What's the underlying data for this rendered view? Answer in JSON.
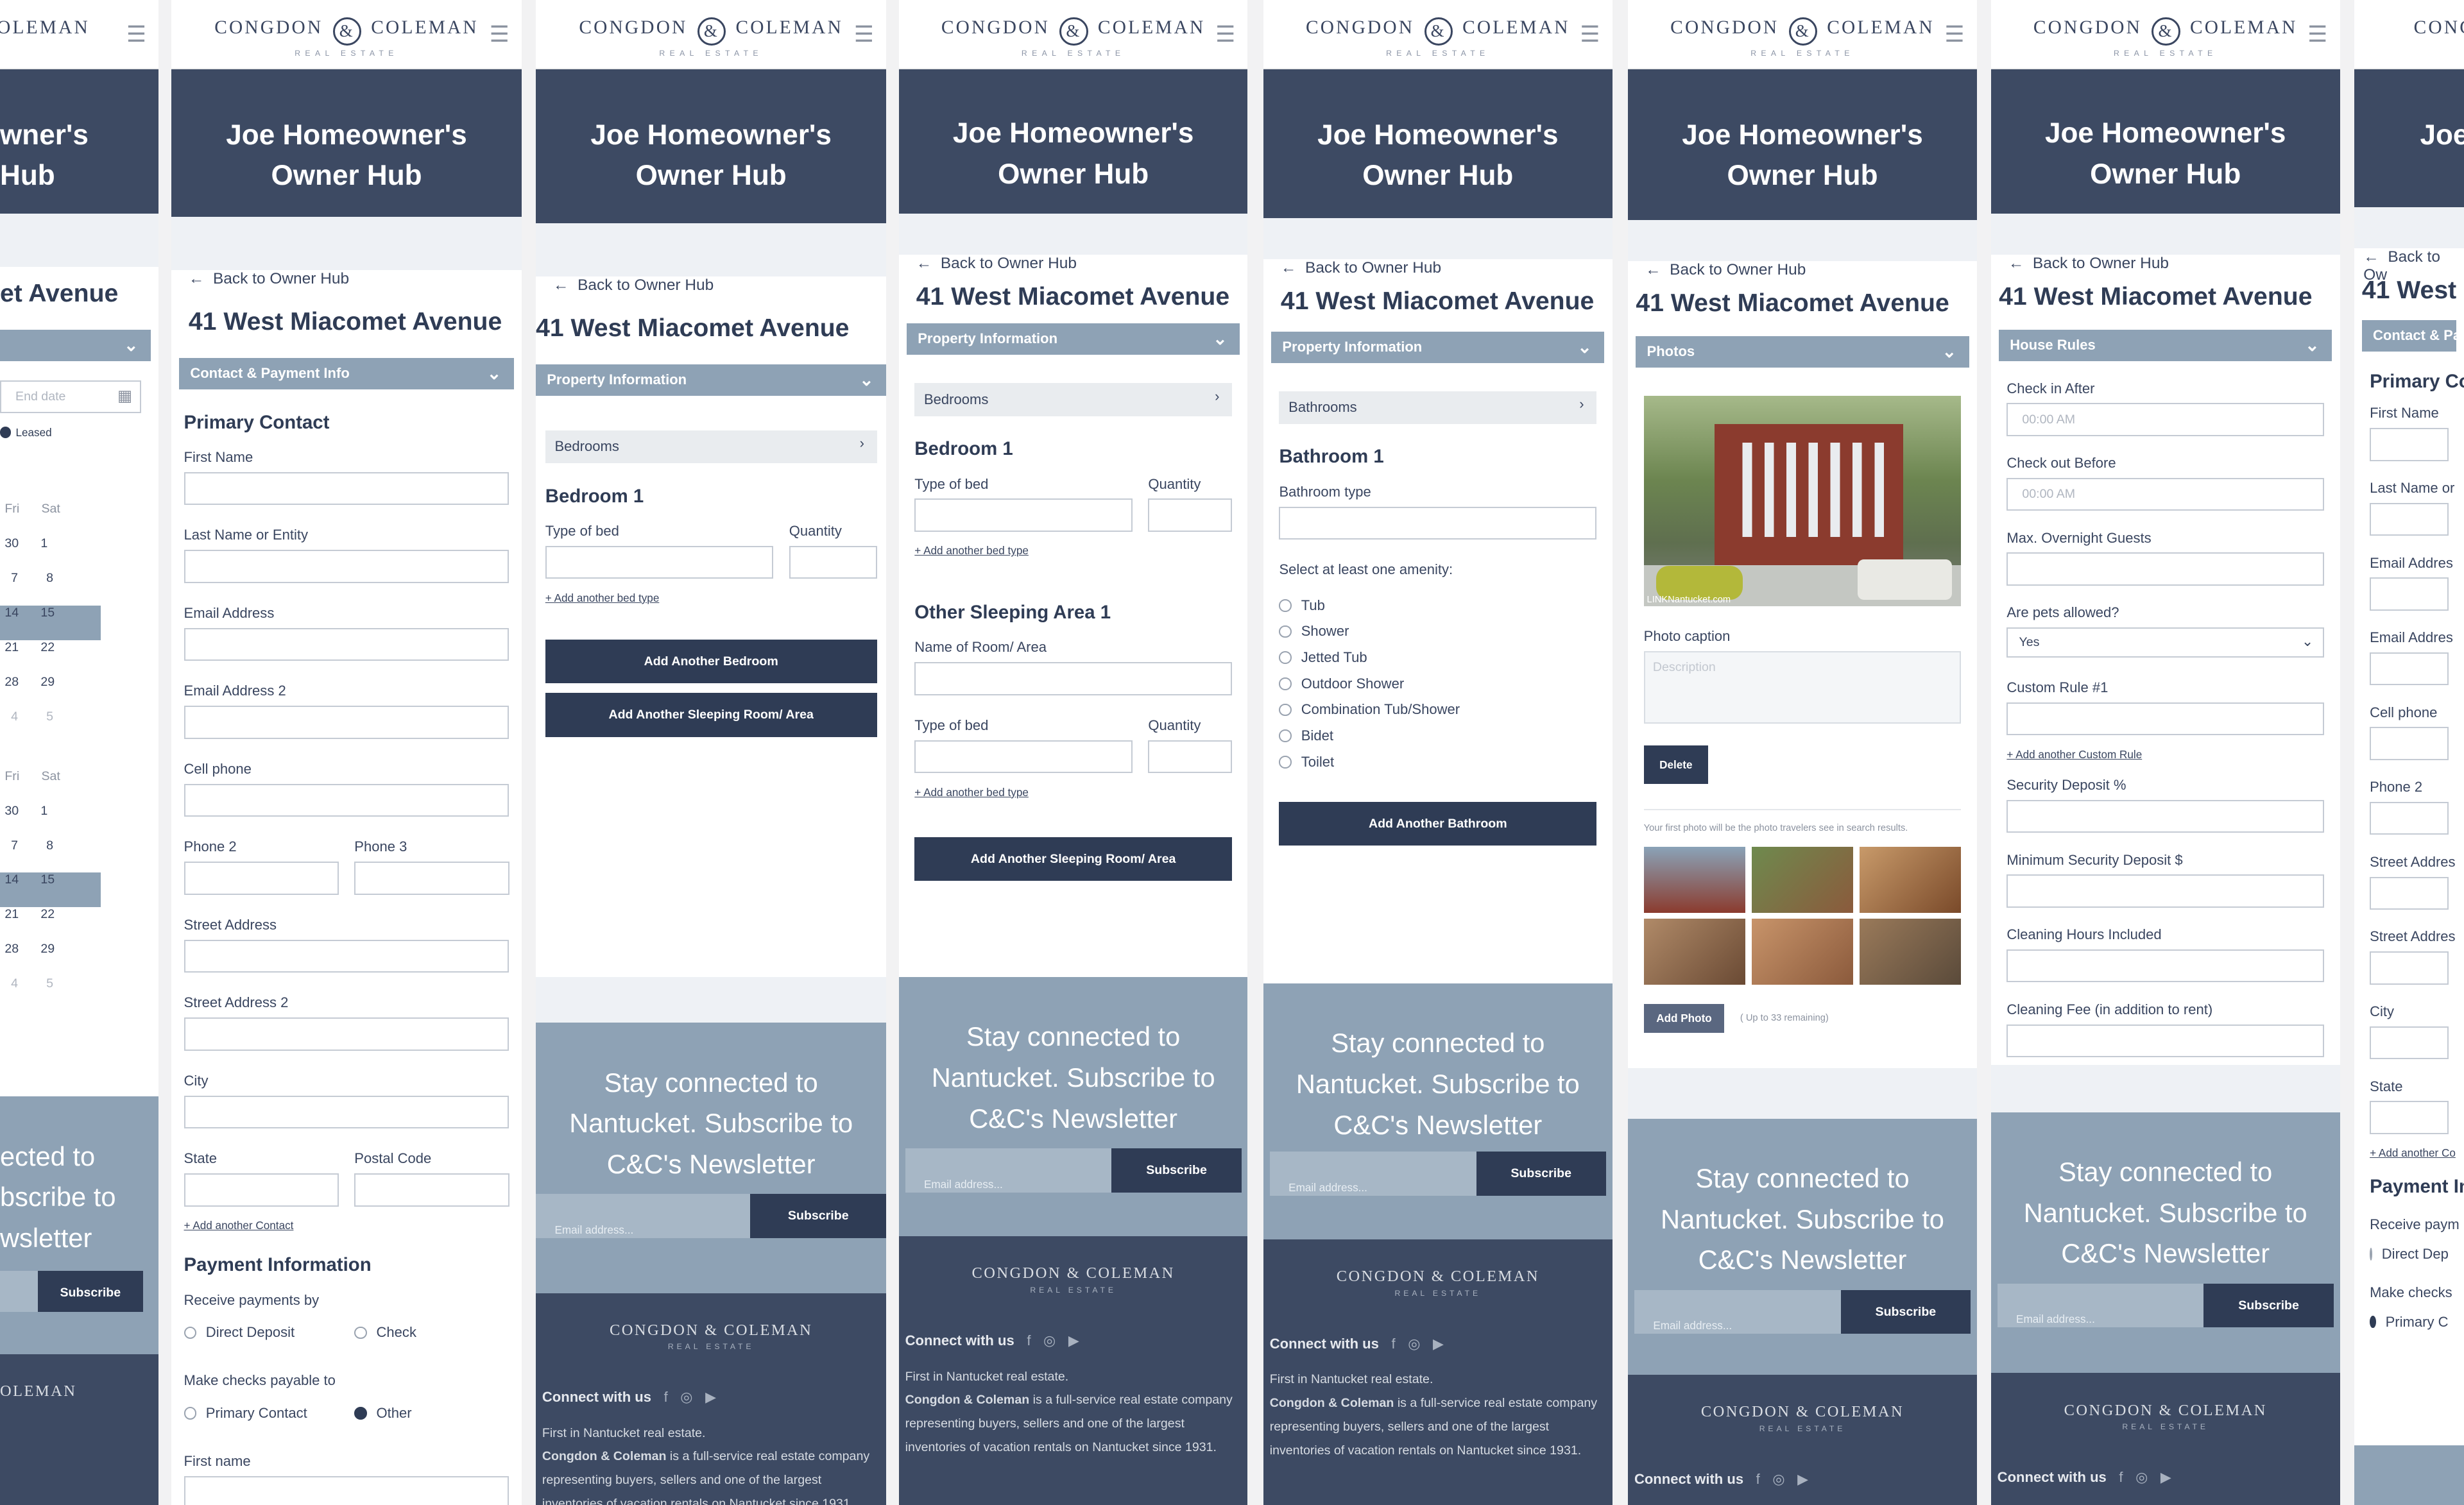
{
  "brand": {
    "name_left": "CONGDON",
    "name_right": "COLEMAN",
    "amp": "&",
    "sub": "REAL ESTATE"
  },
  "hero": {
    "line1": "Joe Homeowner's",
    "line2": "Owner Hub"
  },
  "back_link": "Back to Owner Hub",
  "address": "41 West Miacomet Avenue",
  "newsletter": {
    "line1": "Stay connected to",
    "line2": "Nantucket. Subscribe to",
    "line3": "C&C's Newsletter",
    "placeholder": "Email address...",
    "button": "Subscribe"
  },
  "footer": {
    "connect": "Connect with us",
    "about_line1": "First in Nantucket real estate.",
    "about_bold": "Congdon & Coleman",
    "about_rest": "is a full-service real estate company representing buyers, sellers and one of the largest inventories of vacation rentals on Nantucket since 1931."
  },
  "screen0": {
    "title_frag": "wner's",
    "title_frag2": "Hub",
    "addr_frag": "et Avenue",
    "field": "End date",
    "legend": "Leased",
    "days": [
      "Fri",
      "Sat"
    ],
    "rows1": [
      [
        "30",
        "1"
      ],
      [
        "7",
        "8"
      ],
      [
        "14",
        "15"
      ],
      [
        "21",
        "22"
      ],
      [
        "28",
        "29"
      ],
      [
        "4",
        "5"
      ]
    ],
    "rows2": [
      [
        "30",
        "1"
      ],
      [
        "7",
        "8"
      ],
      [
        "14",
        "15"
      ],
      [
        "21",
        "22"
      ],
      [
        "28",
        "29"
      ],
      [
        "4",
        "5"
      ]
    ],
    "nl1": "ected to",
    "nl2": "bscribe to",
    "nl3": "wsletter",
    "btn": "Subscribe",
    "logo": "OLEMAN"
  },
  "screen1": {
    "bar": "Contact & Payment Info",
    "primary": "Primary Contact",
    "fields": [
      "First Name",
      "Last Name or Entity",
      "Email  Address",
      "Email  Address 2",
      "Cell phone"
    ],
    "phone2": "Phone 2",
    "phone3": "Phone 3",
    "street": "Street Address",
    "street2": "Street Address 2",
    "city": "City",
    "state": "State",
    "postal": "Postal Code",
    "add_contact": "+ Add another Contact",
    "payment": "Payment Information",
    "receive": "Receive payments by",
    "direct": "Direct Deposit",
    "check": "Check",
    "payable": "Make checks payable to",
    "primary_opt": "Primary Contact",
    "other": "Other",
    "firstname": "First name"
  },
  "screen2": {
    "bar": "Property Information",
    "bedrooms": "Bedrooms",
    "bedroom1": "Bedroom 1",
    "type": "Type of bed",
    "qty": "Quantity",
    "add_bed": "+ Add another bed type",
    "btn1": "Add Another Bedroom",
    "btn2": "Add Another Sleeping Room/ Area"
  },
  "screen3": {
    "bar": "Property Information",
    "bedrooms": "Bedrooms",
    "bedroom1": "Bedroom 1",
    "type": "Type of bed",
    "qty": "Quantity",
    "add_bed": "+ Add another bed type",
    "other": "Other Sleeping Area 1",
    "room": "Name of Room/ Area",
    "btn": "Add Another Sleeping Room/ Area"
  },
  "screen4": {
    "bar": "Property Information",
    "bathrooms": "Bathrooms",
    "bathroom1": "Bathroom 1",
    "type": "Bathroom type",
    "amen": "Select at least one amenity:",
    "items": [
      "Tub",
      "Shower",
      "Jetted Tub",
      "Outdoor Shower",
      "Combination Tub/Shower",
      "Bidet",
      "Toilet"
    ],
    "btn": "Add Another Bathroom"
  },
  "screen5": {
    "bar": "Photos",
    "caption_label": "Photo caption",
    "caption_ph": "Description",
    "delete": "Delete",
    "note": "Your first photo will be the photo travelers see in search results.",
    "add": "Add Photo",
    "remaining": "( Up to 33 remaining)",
    "watermark": "LINKNantucket.com"
  },
  "screen6": {
    "bar": "House Rules",
    "checkin": "Check in After",
    "checkin_ph": "00:00 AM",
    "checkout": "Check out Before",
    "checkout_ph": "00:00 AM",
    "guests": "Max. Overnight Guests",
    "pets": "Are pets allowed?",
    "pets_val": "Yes",
    "custom": "Custom Rule #1",
    "add_custom": "+ Add another Custom Rule",
    "deposit": "Security Deposit %",
    "min_dep": "Minimum Security Deposit $",
    "clean_hours": "Cleaning Hours Included",
    "clean_fee": "Cleaning Fee (in addition to rent)"
  },
  "screen7": {
    "hero": "Joe",
    "back": "Back to Ow",
    "addr": "41 West M",
    "bar": "Contact & Pay",
    "primary": "Primary Co",
    "fields": [
      "First Name",
      "Last Name or",
      "Email  Addres",
      "Email  Addres",
      "Cell phone",
      "Phone 2",
      "Street Addres",
      "Street Addres",
      "City",
      "State"
    ],
    "add": "+ Add another Co",
    "payment": "Payment In",
    "receive": "Receive paym",
    "direct": "Direct Dep",
    "make": "Make checks",
    "primary_opt": "Primary C",
    "logo": "CONG"
  }
}
